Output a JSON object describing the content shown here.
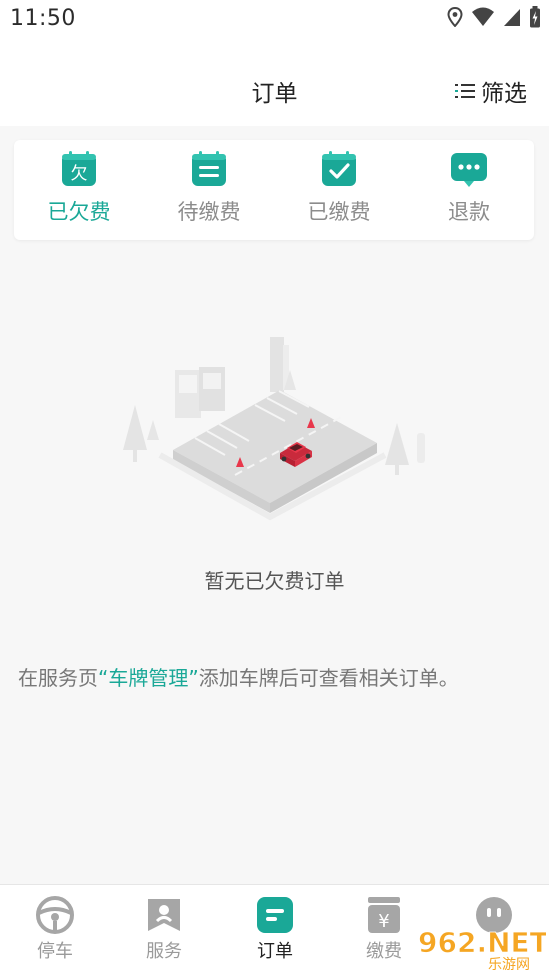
{
  "status": {
    "time": "11:50"
  },
  "header": {
    "title": "订单",
    "filter_label": "筛选"
  },
  "tabs": [
    {
      "label": "已欠费",
      "icon": "arrears-icon",
      "badge": "欠",
      "active": true
    },
    {
      "label": "待缴费",
      "icon": "pending-payment-icon",
      "active": false
    },
    {
      "label": "已缴费",
      "icon": "paid-check-icon",
      "active": false
    },
    {
      "label": "退款",
      "icon": "refund-chat-icon",
      "active": false
    }
  ],
  "empty": {
    "title": "暂无已欠费订单",
    "hint_prefix": "在服务页",
    "hint_link": "“车牌管理”",
    "hint_suffix": "添加车牌后可查看相关订单。"
  },
  "bottom_nav": [
    {
      "label": "停车",
      "icon": "steering-wheel-icon",
      "active": false
    },
    {
      "label": "服务",
      "icon": "service-bookmark-icon",
      "active": false
    },
    {
      "label": "订单",
      "icon": "order-doc-icon",
      "active": true
    },
    {
      "label": "缴费",
      "icon": "payment-yen-icon",
      "active": false
    },
    {
      "label": "",
      "icon": "profile-face-icon",
      "active": false
    }
  ],
  "watermark": {
    "text": "962.NET",
    "subtext": "乐游网"
  },
  "colors": {
    "accent": "#1aa897",
    "accent_light": "#32c3b0",
    "car": "#e8374b"
  }
}
